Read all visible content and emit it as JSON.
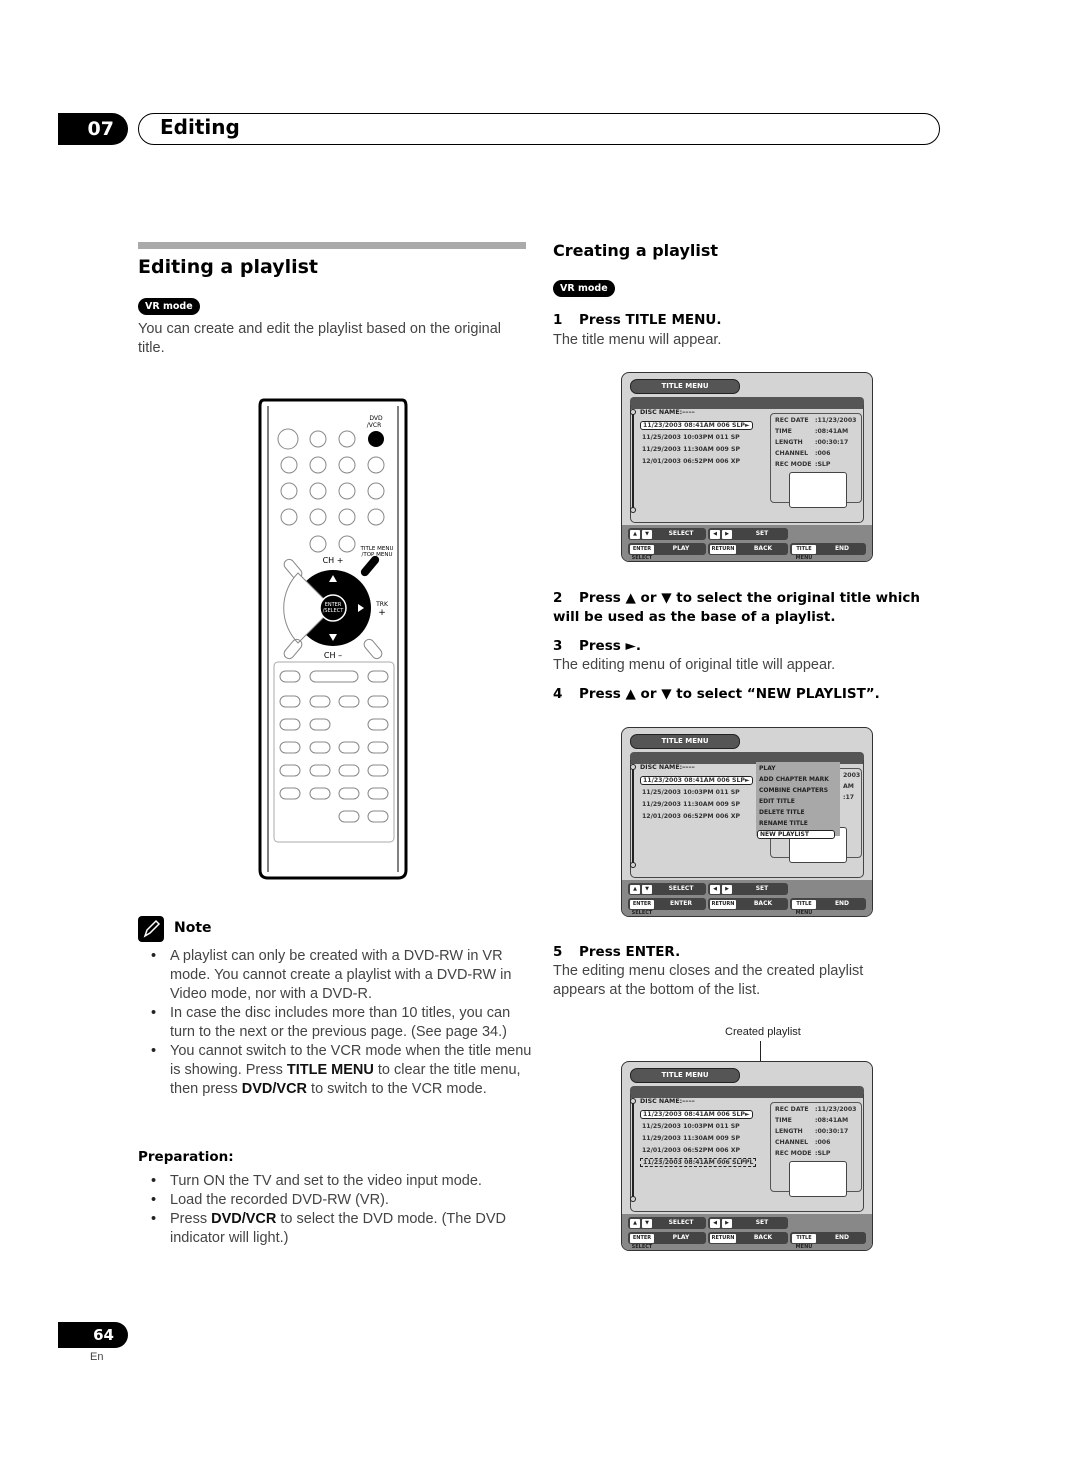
{
  "header": {
    "chapter_number": "07",
    "chapter_title": "Editing"
  },
  "left": {
    "section_title": "Editing a playlist",
    "badge": "VR mode",
    "intro": "You can create and edit the playlist based on the original title.",
    "remote": {
      "dvd_vcr_label": "DVD\n/VCR",
      "title_menu_label": "TITLE MENU\n/TOP MENU",
      "ch_plus": "CH +",
      "ch_minus": "CH –",
      "enter_label": "ENTER\n/SELECT",
      "trk_label": "TRK\n+"
    },
    "note": {
      "title": "Note",
      "items": [
        {
          "text": "A playlist can only be created with a DVD-RW in VR mode. You cannot create a playlist with a DVD-RW in Video mode, nor with a DVD-R."
        },
        {
          "text": "In case the disc includes more than 10 titles, you can turn to the next or the previous page. (See page 34.)"
        },
        {
          "pre": "You cannot switch to the VCR mode when the title menu is showing. Press ",
          "b1": "TITLE MENU",
          "mid": " to clear the title menu, then press ",
          "b2": "DVD/VCR",
          "post": " to switch to the VCR mode."
        }
      ]
    },
    "preparation": {
      "title": "Preparation:",
      "items": [
        {
          "text": "Turn ON the TV and set to the video input mode."
        },
        {
          "text": "Load the recorded DVD-RW (VR)."
        },
        {
          "pre": "Press ",
          "b": "DVD/VCR",
          "post": " to select the DVD mode. (The DVD indicator will light.)"
        }
      ]
    }
  },
  "right": {
    "section_title": "Creating a playlist",
    "badge": "VR mode",
    "steps": [
      {
        "num": "1",
        "title": "Press TITLE MENU.",
        "desc": "The title menu will appear."
      },
      {
        "num": "2",
        "title": "Press ▲ or ▼ to select the original title which will be used as the base of a playlist.",
        "desc": ""
      },
      {
        "num": "3",
        "title": "Press ►.",
        "desc": "The editing menu of original title will appear."
      },
      {
        "num": "4",
        "title": "Press ▲ or ▼ to select “NEW PLAYLIST”.",
        "desc": ""
      },
      {
        "num": "5",
        "title": "Press ENTER.",
        "desc": "The editing menu closes and the created playlist appears at the bottom of the list."
      }
    ],
    "callout": "Created playlist"
  },
  "title_menu": {
    "tab": "TITLE MENU",
    "disc_name": "DISC NAME:––––",
    "rows": [
      "11/23/2003 08:41AM 006 SLP►",
      "11/25/2003 10:03PM 011 SP",
      "11/29/2003 11:30AM 009 SP",
      "12/01/2003 06:52PM 006 XP"
    ],
    "new_row": "11/23/2003 08:41AM 006 SLPPL",
    "info": [
      {
        "k": "REC DATE",
        "v": ":11/23/2003"
      },
      {
        "k": "TIME",
        "v": ":08:41AM"
      },
      {
        "k": "LENGTH",
        "v": ":00:30:17"
      },
      {
        "k": "CHANNEL",
        "v": ":006"
      },
      {
        "k": "REC MODE",
        "v": ":SLP"
      }
    ],
    "edit_menu": [
      "PLAY",
      "ADD CHAPTER MARK",
      "COMBINE CHAPTERS",
      "EDIT TITLE",
      "DELETE TITLE",
      "RENAME TITLE",
      "NEW PLAYLIST"
    ],
    "partial_info": [
      "2003",
      "AM",
      ":17"
    ],
    "footer": {
      "select": "SELECT",
      "set": "SET",
      "play": "PLAY",
      "enter": "ENTER",
      "back": "BACK",
      "end": "END",
      "key_enter": "ENTER SELECT",
      "key_return": "RETURN",
      "key_title": "TITLE MENU"
    }
  },
  "footer": {
    "page": "64",
    "lang": "En"
  }
}
